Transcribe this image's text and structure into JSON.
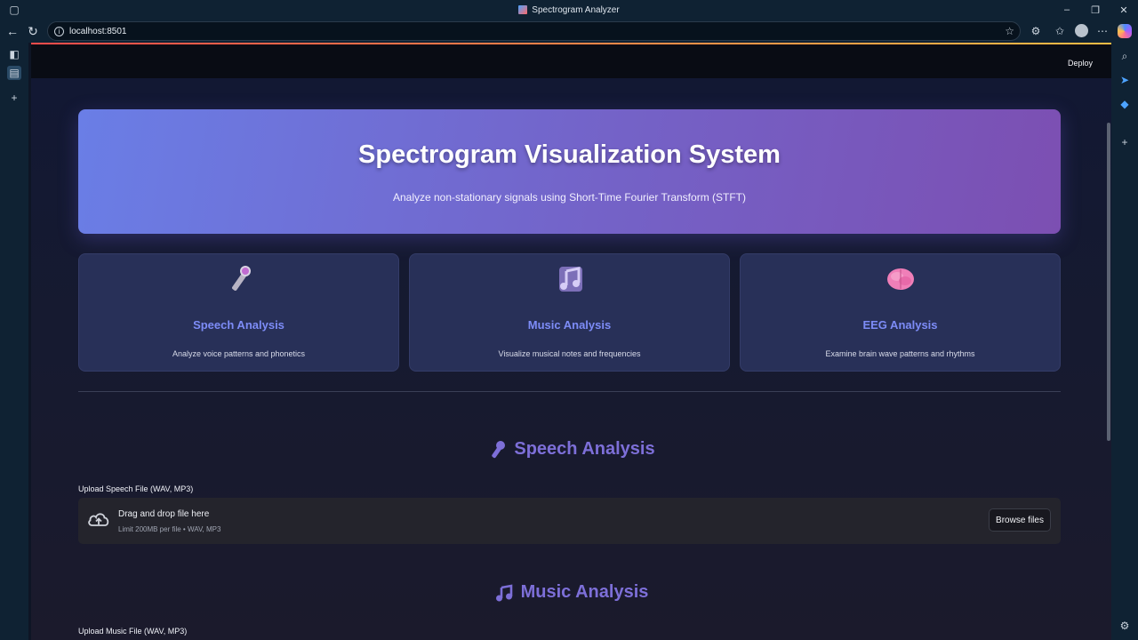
{
  "browser": {
    "tab_title": "Spectrogram Analyzer",
    "url": "localhost:8501"
  },
  "app": {
    "deploy_label": "Deploy",
    "hero": {
      "title": "Spectrogram Visualization System",
      "subtitle": "Analyze non-stationary signals using Short-Time Fourier Transform (STFT)"
    },
    "cards": [
      {
        "icon": "microphone-icon",
        "title": "Speech Analysis",
        "description": "Analyze voice patterns and phonetics"
      },
      {
        "icon": "music-note-icon",
        "title": "Music Analysis",
        "description": "Visualize musical notes and frequencies"
      },
      {
        "icon": "brain-icon",
        "title": "EEG Analysis",
        "description": "Examine brain wave patterns and rhythms"
      }
    ],
    "speech_section": {
      "heading": "Speech Analysis",
      "upload_label": "Upload Speech File (WAV, MP3)",
      "dropzone_main": "Drag and drop file here",
      "dropzone_limit": "Limit 200MB per file • WAV, MP3",
      "browse_label": "Browse files"
    },
    "music_section": {
      "heading": "Music Analysis",
      "upload_label": "Upload Music File (WAV, MP3)"
    }
  },
  "colors": {
    "hero_start": "#6a7ee6",
    "hero_end": "#7c4fb2",
    "card_title": "#7d8cf7",
    "section_heading": "#7d6fd8"
  }
}
